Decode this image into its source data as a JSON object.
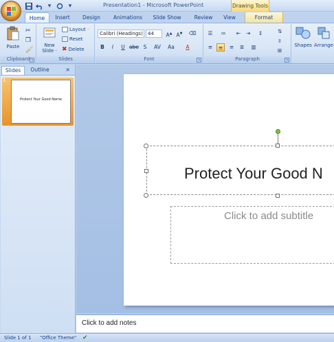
{
  "app": {
    "title": "Presentation1 - Microsoft PowerPoint",
    "contextual_tab_group": "Drawing Tools"
  },
  "quick_access": {
    "icons": [
      "save-icon",
      "undo-icon",
      "redo-icon",
      "customize-icon"
    ]
  },
  "tabs": [
    {
      "label": "Home",
      "active": true
    },
    {
      "label": "Insert"
    },
    {
      "label": "Design"
    },
    {
      "label": "Animations"
    },
    {
      "label": "Slide Show"
    },
    {
      "label": "Review"
    },
    {
      "label": "View"
    },
    {
      "label": "Format"
    }
  ],
  "ribbon": {
    "clipboard": {
      "label": "Clipboard",
      "paste": "Paste"
    },
    "slides": {
      "label": "Slides",
      "new_slide": "New Slide ·",
      "layout": "Layout ·",
      "reset": "Reset",
      "delete": "Delete"
    },
    "font": {
      "label": "Font",
      "font_name": "Calibri (Headings)",
      "font_size": "44"
    },
    "paragraph": {
      "label": "Paragraph"
    },
    "drawing": {
      "shapes": "Shapes",
      "arrange": "Arrange"
    }
  },
  "left_pane": {
    "tabs": [
      {
        "label": "Slides",
        "active": true
      },
      {
        "label": "Outline"
      }
    ],
    "close": "×",
    "thumbnails": [
      {
        "number": "1",
        "title": "Protect Your Good Name"
      }
    ]
  },
  "slide": {
    "title": "Protect Your Good N",
    "subtitle_placeholder": "Click to add subtitle"
  },
  "notes": {
    "placeholder": "Click to add notes"
  },
  "status_bar": {
    "slide_count": "Slide 1 of 1",
    "theme": "\"Office Theme\""
  },
  "colors": {
    "ribbon_bg": "#d9e6f6",
    "tab_text": "#15428b",
    "contextual": "#f6d97b",
    "selected_thumb": "#e7932b",
    "rotation_handle": "#7dc04b"
  }
}
